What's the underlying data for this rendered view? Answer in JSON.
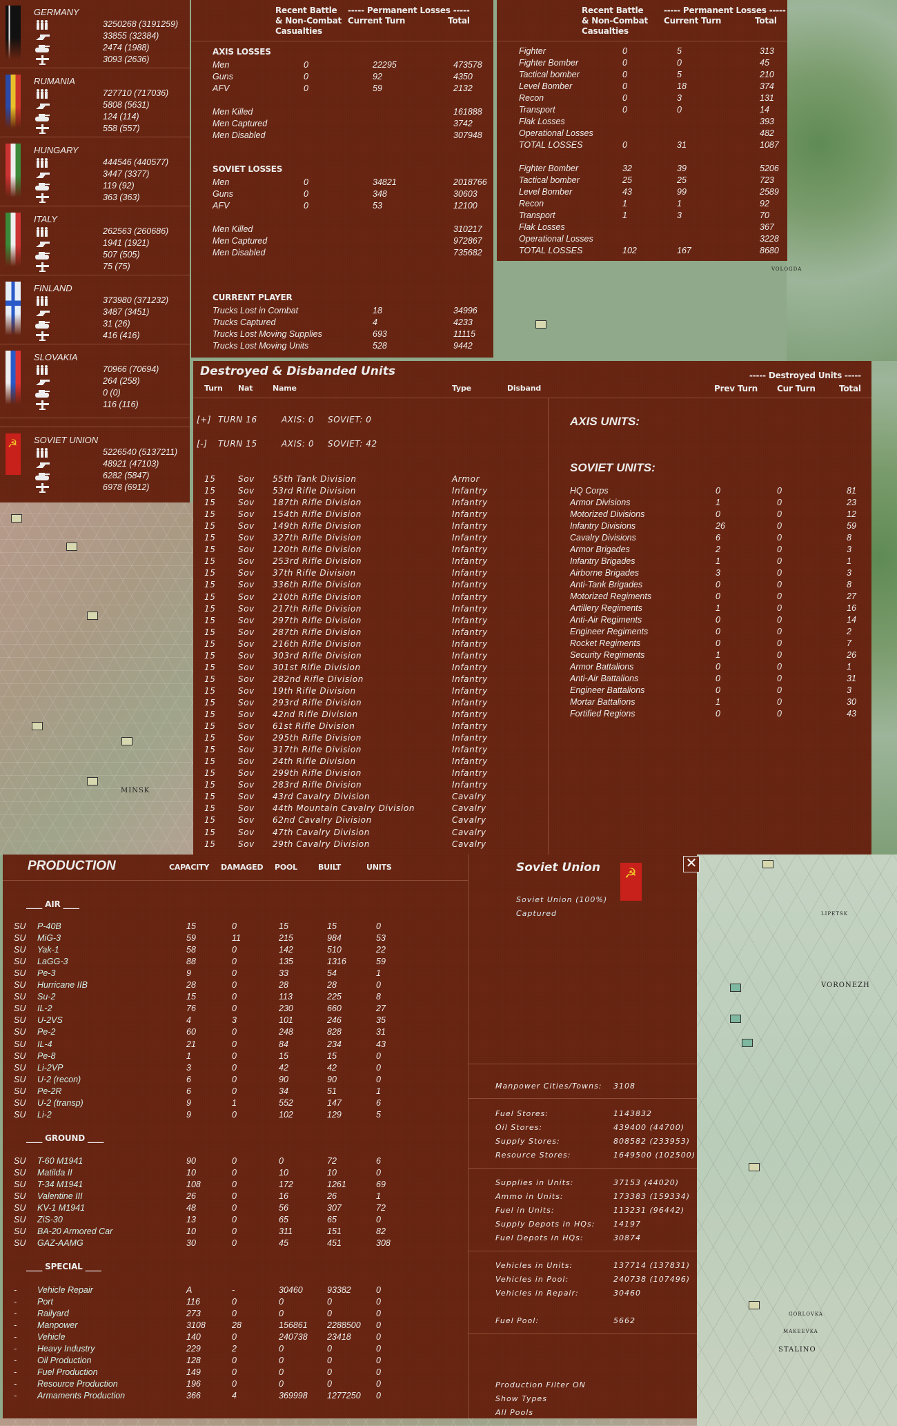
{
  "nations": [
    {
      "name": "GERMANY",
      "flag": "germany",
      "men": "3250268 (3191259)",
      "guns": "33855 (32384)",
      "afv": "2474 (1988)",
      "air": "3093 (2636)"
    },
    {
      "name": "RUMANIA",
      "flag": "rumania",
      "men": "727710 (717036)",
      "guns": "5808 (5631)",
      "afv": "124 (114)",
      "air": "558 (557)"
    },
    {
      "name": "HUNGARY",
      "flag": "hungary",
      "men": "444546 (440577)",
      "guns": "3447 (3377)",
      "afv": "119 (92)",
      "air": "363 (363)"
    },
    {
      "name": "ITALY",
      "flag": "italy",
      "men": "262563 (260686)",
      "guns": "1941 (1921)",
      "afv": "507 (505)",
      "air": "75 (75)"
    },
    {
      "name": "FINLAND",
      "flag": "finland",
      "men": "373980 (371232)",
      "guns": "3487 (3451)",
      "afv": "31 (26)",
      "air": "416 (416)"
    },
    {
      "name": "SLOVAKIA",
      "flag": "slovakia",
      "men": "70966 (70694)",
      "guns": "264 (258)",
      "afv": "0 (0)",
      "air": "116 (116)"
    },
    {
      "name": "SOVIET UNION",
      "flag": "soviet",
      "men": "5226540 (5137211)",
      "guns": "48921 (47103)",
      "afv": "6282 (5847)",
      "air": "6978 (6912)"
    }
  ],
  "losses_header": {
    "recent1": "Recent Battle",
    "recent2": "& Non-Combat",
    "recent3": "Casualties",
    "perm": "----- Permanent Losses -----",
    "current": "Current Turn",
    "total": "Total"
  },
  "ground_losses": {
    "axis_title": "AXIS LOSSES",
    "axis_rows": [
      [
        "Men",
        "0",
        "22295",
        "473578"
      ],
      [
        "Guns",
        "0",
        "92",
        "4350"
      ],
      [
        "AFV",
        "0",
        "59",
        "2132"
      ]
    ],
    "axis_extra": [
      [
        "Men Killed",
        "161888"
      ],
      [
        "Men Captured",
        "3742"
      ],
      [
        "Men Disabled",
        "307948"
      ]
    ],
    "soviet_title": "SOVIET LOSSES",
    "soviet_rows": [
      [
        "Men",
        "0",
        "34821",
        "2018766"
      ],
      [
        "Guns",
        "0",
        "348",
        "30603"
      ],
      [
        "AFV",
        "0",
        "53",
        "12100"
      ]
    ],
    "soviet_extra": [
      [
        "Men Killed",
        "310217"
      ],
      [
        "Men Captured",
        "972867"
      ],
      [
        "Men Disabled",
        "735682"
      ]
    ],
    "player_title": "CURRENT PLAYER",
    "player_rows": [
      [
        "Trucks Lost in Combat",
        "18",
        "34996"
      ],
      [
        "Trucks Captured",
        "4",
        "4233"
      ],
      [
        "Trucks Lost Moving Supplies",
        "693",
        "11115"
      ],
      [
        "Trucks Lost Moving Units",
        "528",
        "9442"
      ]
    ]
  },
  "air_losses": {
    "axis": [
      [
        "Fighter",
        "0",
        "5",
        "313"
      ],
      [
        "Fighter Bomber",
        "0",
        "0",
        "45"
      ],
      [
        "Tactical bomber",
        "0",
        "5",
        "210"
      ],
      [
        "Level Bomber",
        "0",
        "18",
        "374"
      ],
      [
        "Recon",
        "0",
        "3",
        "131"
      ],
      [
        "Transport",
        "0",
        "0",
        "14"
      ],
      [
        "Flak Losses",
        "",
        "",
        "393"
      ],
      [
        "Operational Losses",
        "",
        "",
        "482"
      ],
      [
        "TOTAL LOSSES",
        "0",
        "31",
        "1087"
      ]
    ],
    "soviet": [
      [
        "Fighter Bomber",
        "32",
        "39",
        "5206"
      ],
      [
        "Tactical bomber",
        "25",
        "25",
        "723"
      ],
      [
        "Level Bomber",
        "43",
        "99",
        "2589"
      ],
      [
        "Recon",
        "1",
        "1",
        "92"
      ],
      [
        "Transport",
        "1",
        "3",
        "70"
      ],
      [
        "Flak Losses",
        "",
        "",
        "367"
      ],
      [
        "Operational Losses",
        "",
        "",
        "3228"
      ],
      [
        "TOTAL LOSSES",
        "102",
        "167",
        "8680"
      ]
    ]
  },
  "destroyed": {
    "title": "Destroyed & Disbanded Units",
    "headers": {
      "turn": "Turn",
      "nat": "Nat",
      "name": "Name",
      "type": "Type",
      "disband": "Disband"
    },
    "turns": [
      {
        "toggle": "[+]",
        "turn": "TURN 16",
        "axis": "AXIS: 0",
        "soviet": "SOVIET: 0"
      },
      {
        "toggle": "[-]",
        "turn": "TURN 15",
        "axis": "AXIS: 0",
        "soviet": "SOVIET: 42"
      }
    ],
    "units": [
      [
        "15",
        "Sov",
        "55th Tank Division",
        "Armor"
      ],
      [
        "15",
        "Sov",
        "53rd Rifle Division",
        "Infantry"
      ],
      [
        "15",
        "Sov",
        "187th Rifle Division",
        "Infantry"
      ],
      [
        "15",
        "Sov",
        "154th Rifle Division",
        "Infantry"
      ],
      [
        "15",
        "Sov",
        "149th Rifle Division",
        "Infantry"
      ],
      [
        "15",
        "Sov",
        "327th Rifle Division",
        "Infantry"
      ],
      [
        "15",
        "Sov",
        "120th Rifle Division",
        "Infantry"
      ],
      [
        "15",
        "Sov",
        "253rd Rifle Division",
        "Infantry"
      ],
      [
        "15",
        "Sov",
        "37th Rifle Division",
        "Infantry"
      ],
      [
        "15",
        "Sov",
        "336th Rifle Division",
        "Infantry"
      ],
      [
        "15",
        "Sov",
        "210th Rifle Division",
        "Infantry"
      ],
      [
        "15",
        "Sov",
        "217th Rifle Division",
        "Infantry"
      ],
      [
        "15",
        "Sov",
        "297th Rifle Division",
        "Infantry"
      ],
      [
        "15",
        "Sov",
        "287th Rifle Division",
        "Infantry"
      ],
      [
        "15",
        "Sov",
        "216th Rifle Division",
        "Infantry"
      ],
      [
        "15",
        "Sov",
        "303rd Rifle Division",
        "Infantry"
      ],
      [
        "15",
        "Sov",
        "301st Rifle Division",
        "Infantry"
      ],
      [
        "15",
        "Sov",
        "282nd Rifle Division",
        "Infantry"
      ],
      [
        "15",
        "Sov",
        "19th Rifle Division",
        "Infantry"
      ],
      [
        "15",
        "Sov",
        "293rd Rifle Division",
        "Infantry"
      ],
      [
        "15",
        "Sov",
        "42nd Rifle Division",
        "Infantry"
      ],
      [
        "15",
        "Sov",
        "61st Rifle Division",
        "Infantry"
      ],
      [
        "15",
        "Sov",
        "295th Rifle Division",
        "Infantry"
      ],
      [
        "15",
        "Sov",
        "317th Rifle Division",
        "Infantry"
      ],
      [
        "15",
        "Sov",
        "24th Rifle Division",
        "Infantry"
      ],
      [
        "15",
        "Sov",
        "299th Rifle Division",
        "Infantry"
      ],
      [
        "15",
        "Sov",
        "283rd Rifle Division",
        "Infantry"
      ],
      [
        "15",
        "Sov",
        "43rd Cavalry Division",
        "Cavalry"
      ],
      [
        "15",
        "Sov",
        "44th Mountain Cavalry Division",
        "Cavalry"
      ],
      [
        "15",
        "Sov",
        "62nd Cavalry Division",
        "Cavalry"
      ],
      [
        "15",
        "Sov",
        "47th Cavalry Division",
        "Cavalry"
      ],
      [
        "15",
        "Sov",
        "29th Cavalry Division",
        "Cavalry"
      ]
    ],
    "summary_header": "----- Destroyed Units -----",
    "summary_cols": {
      "prev": "Prev Turn",
      "cur": "Cur Turn",
      "total": "Total"
    },
    "axis_units_title": "AXIS UNITS:",
    "soviet_units_title": "SOVIET UNITS:",
    "soviet_units": [
      [
        "HQ Corps",
        "0",
        "0",
        "81"
      ],
      [
        "Armor Divisions",
        "1",
        "0",
        "23"
      ],
      [
        "Motorized Divisions",
        "0",
        "0",
        "12"
      ],
      [
        "Infantry Divisions",
        "26",
        "0",
        "59"
      ],
      [
        "Cavalry Divisions",
        "6",
        "0",
        "8"
      ],
      [
        "Armor Brigades",
        "2",
        "0",
        "3"
      ],
      [
        "Infantry Brigades",
        "1",
        "0",
        "1"
      ],
      [
        "Airborne Brigades",
        "3",
        "0",
        "3"
      ],
      [
        "Anti-Tank Brigades",
        "0",
        "0",
        "8"
      ],
      [
        "Motorized Regiments",
        "0",
        "0",
        "27"
      ],
      [
        "Artillery Regiments",
        "1",
        "0",
        "16"
      ],
      [
        "Anti-Air Regiments",
        "0",
        "0",
        "14"
      ],
      [
        "Engineer Regiments",
        "0",
        "0",
        "2"
      ],
      [
        "Rocket Regiments",
        "0",
        "0",
        "7"
      ],
      [
        "Security Regiments",
        "1",
        "0",
        "26"
      ],
      [
        "Armor Battalions",
        "0",
        "0",
        "1"
      ],
      [
        "Anti-Air Battalions",
        "0",
        "0",
        "31"
      ],
      [
        "Engineer Battalions",
        "0",
        "0",
        "3"
      ],
      [
        "Mortar Battalions",
        "1",
        "0",
        "30"
      ],
      [
        "Fortified Regions",
        "0",
        "0",
        "43"
      ]
    ]
  },
  "production": {
    "title": "PRODUCTION",
    "cols": [
      "CAPACITY",
      "DAMAGED",
      "POOL",
      "BUILT",
      "UNITS"
    ],
    "air_title": "____  AIR  ____",
    "air": [
      [
        "SU",
        "P-40B",
        "15",
        "0",
        "15",
        "15",
        "0"
      ],
      [
        "SU",
        "MiG-3",
        "59",
        "11",
        "215",
        "984",
        "53"
      ],
      [
        "SU",
        "Yak-1",
        "58",
        "0",
        "142",
        "510",
        "22"
      ],
      [
        "SU",
        "LaGG-3",
        "88",
        "0",
        "135",
        "1316",
        "59"
      ],
      [
        "SU",
        "Pe-3",
        "9",
        "0",
        "33",
        "54",
        "1"
      ],
      [
        "SU",
        "Hurricane IIB",
        "28",
        "0",
        "28",
        "28",
        "0"
      ],
      [
        "SU",
        "Su-2",
        "15",
        "0",
        "113",
        "225",
        "8"
      ],
      [
        "SU",
        "IL-2",
        "76",
        "0",
        "230",
        "660",
        "27"
      ],
      [
        "SU",
        "U-2VS",
        "4",
        "3",
        "101",
        "246",
        "35"
      ],
      [
        "SU",
        "Pe-2",
        "60",
        "0",
        "248",
        "828",
        "31"
      ],
      [
        "SU",
        "IL-4",
        "21",
        "0",
        "84",
        "234",
        "43"
      ],
      [
        "SU",
        "Pe-8",
        "1",
        "0",
        "15",
        "15",
        "0"
      ],
      [
        "SU",
        "Li-2VP",
        "3",
        "0",
        "42",
        "42",
        "0"
      ],
      [
        "SU",
        "U-2 (recon)",
        "6",
        "0",
        "90",
        "90",
        "0"
      ],
      [
        "SU",
        "Pe-2R",
        "6",
        "0",
        "34",
        "51",
        "1"
      ],
      [
        "SU",
        "U-2 (transp)",
        "9",
        "1",
        "552",
        "147",
        "6"
      ],
      [
        "SU",
        "Li-2",
        "9",
        "0",
        "102",
        "129",
        "5"
      ]
    ],
    "ground_title": "____ GROUND ____",
    "ground": [
      [
        "SU",
        "T-60 M1941",
        "90",
        "0",
        "0",
        "72",
        "6"
      ],
      [
        "SU",
        "Matilda II",
        "10",
        "0",
        "10",
        "10",
        "0"
      ],
      [
        "SU",
        "T-34 M1941",
        "108",
        "0",
        "172",
        "1261",
        "69"
      ],
      [
        "SU",
        "Valentine III",
        "26",
        "0",
        "16",
        "26",
        "1"
      ],
      [
        "SU",
        "KV-1 M1941",
        "48",
        "0",
        "56",
        "307",
        "72"
      ],
      [
        "SU",
        "ZiS-30",
        "13",
        "0",
        "65",
        "65",
        "0"
      ],
      [
        "SU",
        "BA-20 Armored Car",
        "10",
        "0",
        "311",
        "151",
        "82"
      ],
      [
        "SU",
        "GAZ-AAMG",
        "30",
        "0",
        "45",
        "451",
        "308"
      ]
    ],
    "special_title": "____ SPECIAL ____",
    "special": [
      [
        "-",
        "Vehicle Repair",
        "A",
        "-",
        "30460",
        "93382",
        "0"
      ],
      [
        "-",
        "Port",
        "116",
        "0",
        "0",
        "0",
        "0"
      ],
      [
        "-",
        "Railyard",
        "273",
        "0",
        "0",
        "0",
        "0"
      ],
      [
        "-",
        "Manpower",
        "3108",
        "28",
        "156861",
        "2288500",
        "0"
      ],
      [
        "-",
        "Vehicle",
        "140",
        "0",
        "240738",
        "23418",
        "0"
      ],
      [
        "-",
        "Heavy Industry",
        "229",
        "2",
        "0",
        "0",
        "0"
      ],
      [
        "-",
        "Oil Production",
        "128",
        "0",
        "0",
        "0",
        "0"
      ],
      [
        "-",
        "Fuel Production",
        "149",
        "0",
        "0",
        "0",
        "0"
      ],
      [
        "-",
        "Resource Production",
        "196",
        "0",
        "0",
        "0",
        "0"
      ],
      [
        "-",
        "Armaments Production",
        "366",
        "4",
        "369998",
        "1277250",
        "0"
      ]
    ]
  },
  "nation_info": {
    "title": "Soviet Union",
    "subtitle": "Soviet Union  (100%)",
    "captured": "Captured",
    "close": "✕",
    "stats": [
      [
        [
          "Manpower Cities/Towns:",
          "3108"
        ]
      ],
      [
        [
          "Fuel Stores:",
          "1143832"
        ],
        [
          "Oil Stores:",
          "439400 (44700)"
        ],
        [
          "Supply Stores:",
          "808582 (233953)"
        ],
        [
          "Resource Stores:",
          "1649500 (102500)"
        ]
      ],
      [
        [
          "Supplies in Units:",
          "37153 (44020)"
        ],
        [
          "Ammo in Units:",
          "173383 (159334)"
        ],
        [
          "Fuel in Units:",
          "113231 (96442)"
        ],
        [
          "Supply Depots in HQs:",
          "14197"
        ],
        [
          "Fuel Depots in HQs:",
          "30874"
        ]
      ],
      [
        [
          "Vehicles in Units:",
          "137714 (137831)"
        ],
        [
          "Vehicles in Pool:",
          "240738 (107496)"
        ],
        [
          "Vehicles in Repair:",
          "30460"
        ],
        [
          "",
          ""
        ],
        [
          "Fuel Pool:",
          "5662"
        ]
      ]
    ],
    "options": [
      "Production Filter ON",
      "Show Types",
      "All Pools"
    ]
  },
  "map_labels": [
    "VOLOGDA",
    "MINSK",
    "VORONEZH",
    "STALINO",
    "LIPETSK",
    "GORLOVKA",
    "MAKEEVKA"
  ],
  "colors": {
    "panel": "#6a2612",
    "text": "#ececec",
    "divider": "#8e4d36"
  }
}
